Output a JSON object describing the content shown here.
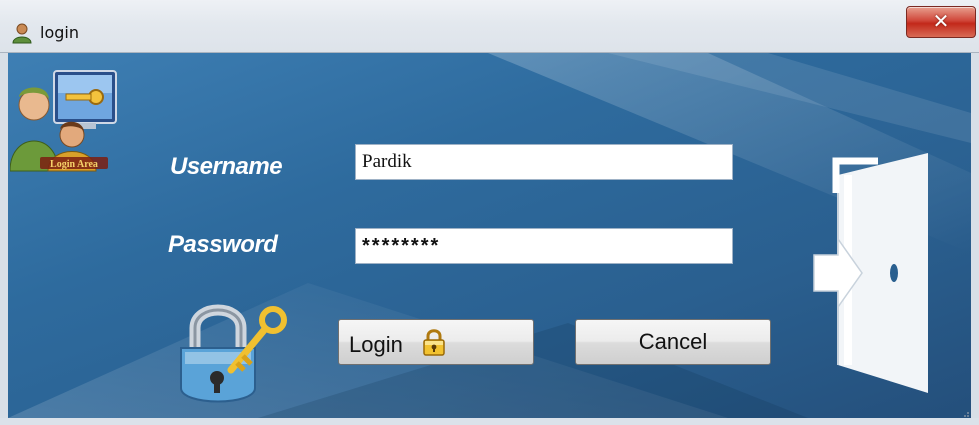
{
  "window": {
    "title": "login",
    "close_glyph": "✕",
    "icons": {
      "title": "user-icon",
      "close": "close-icon"
    }
  },
  "client": {
    "area_icon": {
      "name": "login-area-icon",
      "caption": "Login Area"
    },
    "username": {
      "label": "Username",
      "value": "Pardik"
    },
    "password": {
      "label": "Password",
      "value": "********"
    },
    "buttons": {
      "login": "Login",
      "cancel": "Cancel"
    },
    "icons": {
      "padlock": "padlock-key-icon",
      "login_lock": "lock-icon",
      "exit": "exit-door-icon"
    }
  },
  "colors": {
    "background": "#2e6b9e",
    "label_text": "#ffffff",
    "close_button": "#c2281a",
    "accent_gold": "#e0a820"
  }
}
